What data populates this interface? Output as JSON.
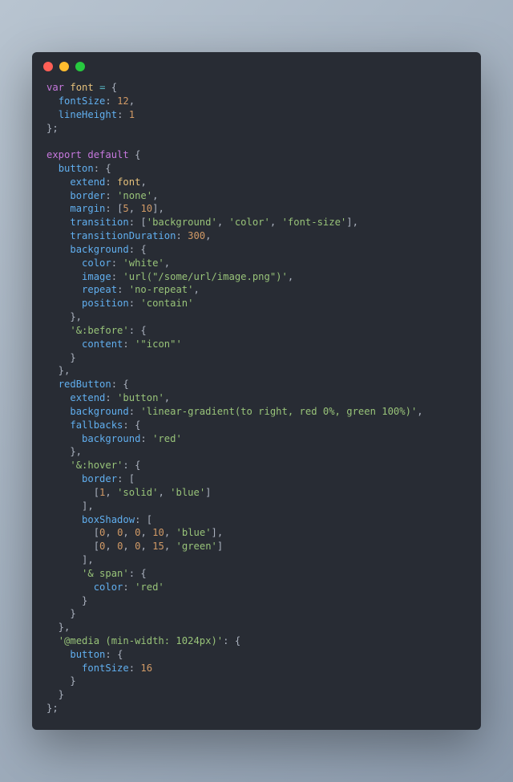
{
  "titlebar": {
    "dots": [
      "close",
      "minimize",
      "zoom"
    ]
  },
  "code": {
    "tokens": [
      [
        [
          "k",
          "var"
        ],
        [
          "p",
          " "
        ],
        [
          "con",
          "font"
        ],
        [
          "p",
          " "
        ],
        [
          "op",
          "="
        ],
        [
          "p",
          " {"
        ]
      ],
      [
        [
          "p",
          "  "
        ],
        [
          "prop",
          "fontSize"
        ],
        [
          "p",
          ": "
        ],
        [
          "num",
          "12"
        ],
        [
          "p",
          ","
        ]
      ],
      [
        [
          "p",
          "  "
        ],
        [
          "prop",
          "lineHeight"
        ],
        [
          "p",
          ": "
        ],
        [
          "num",
          "1"
        ]
      ],
      [
        [
          "p",
          "};"
        ]
      ],
      [
        [
          "p",
          ""
        ]
      ],
      [
        [
          "k",
          "export"
        ],
        [
          "p",
          " "
        ],
        [
          "k",
          "default"
        ],
        [
          "p",
          " {"
        ]
      ],
      [
        [
          "p",
          "  "
        ],
        [
          "prop",
          "button"
        ],
        [
          "p",
          ": {"
        ]
      ],
      [
        [
          "p",
          "    "
        ],
        [
          "prop",
          "extend"
        ],
        [
          "p",
          ": "
        ],
        [
          "con",
          "font"
        ],
        [
          "p",
          ","
        ]
      ],
      [
        [
          "p",
          "    "
        ],
        [
          "prop",
          "border"
        ],
        [
          "p",
          ": "
        ],
        [
          "str",
          "'none'"
        ],
        [
          "p",
          ","
        ]
      ],
      [
        [
          "p",
          "    "
        ],
        [
          "prop",
          "margin"
        ],
        [
          "p",
          ": ["
        ],
        [
          "num",
          "5"
        ],
        [
          "p",
          ", "
        ],
        [
          "num",
          "10"
        ],
        [
          "p",
          "],"
        ]
      ],
      [
        [
          "p",
          "    "
        ],
        [
          "prop",
          "transition"
        ],
        [
          "p",
          ": ["
        ],
        [
          "str",
          "'background'"
        ],
        [
          "p",
          ", "
        ],
        [
          "str",
          "'color'"
        ],
        [
          "p",
          ", "
        ],
        [
          "str",
          "'font-size'"
        ],
        [
          "p",
          "],"
        ]
      ],
      [
        [
          "p",
          "    "
        ],
        [
          "prop",
          "transitionDuration"
        ],
        [
          "p",
          ": "
        ],
        [
          "num",
          "300"
        ],
        [
          "p",
          ","
        ]
      ],
      [
        [
          "p",
          "    "
        ],
        [
          "prop",
          "background"
        ],
        [
          "p",
          ": {"
        ]
      ],
      [
        [
          "p",
          "      "
        ],
        [
          "prop",
          "color"
        ],
        [
          "p",
          ": "
        ],
        [
          "str",
          "'white'"
        ],
        [
          "p",
          ","
        ]
      ],
      [
        [
          "p",
          "      "
        ],
        [
          "prop",
          "image"
        ],
        [
          "p",
          ": "
        ],
        [
          "str",
          "'url(\"/some/url/image.png\")'"
        ],
        [
          "p",
          ","
        ]
      ],
      [
        [
          "p",
          "      "
        ],
        [
          "prop",
          "repeat"
        ],
        [
          "p",
          ": "
        ],
        [
          "str",
          "'no-repeat'"
        ],
        [
          "p",
          ","
        ]
      ],
      [
        [
          "p",
          "      "
        ],
        [
          "prop",
          "position"
        ],
        [
          "p",
          ": "
        ],
        [
          "str",
          "'contain'"
        ]
      ],
      [
        [
          "p",
          "    },"
        ]
      ],
      [
        [
          "p",
          "    "
        ],
        [
          "str",
          "'&:before'"
        ],
        [
          "p",
          ": {"
        ]
      ],
      [
        [
          "p",
          "      "
        ],
        [
          "prop",
          "content"
        ],
        [
          "p",
          ": "
        ],
        [
          "str",
          "'\"icon\"'"
        ]
      ],
      [
        [
          "p",
          "    }"
        ]
      ],
      [
        [
          "p",
          "  },"
        ]
      ],
      [
        [
          "p",
          "  "
        ],
        [
          "prop",
          "redButton"
        ],
        [
          "p",
          ": {"
        ]
      ],
      [
        [
          "p",
          "    "
        ],
        [
          "prop",
          "extend"
        ],
        [
          "p",
          ": "
        ],
        [
          "str",
          "'button'"
        ],
        [
          "p",
          ","
        ]
      ],
      [
        [
          "p",
          "    "
        ],
        [
          "prop",
          "background"
        ],
        [
          "p",
          ": "
        ],
        [
          "str",
          "'linear-gradient(to right, red 0%, green 100%)'"
        ],
        [
          "p",
          ","
        ]
      ],
      [
        [
          "p",
          "    "
        ],
        [
          "prop",
          "fallbacks"
        ],
        [
          "p",
          ": {"
        ]
      ],
      [
        [
          "p",
          "      "
        ],
        [
          "prop",
          "background"
        ],
        [
          "p",
          ": "
        ],
        [
          "str",
          "'red'"
        ]
      ],
      [
        [
          "p",
          "    },"
        ]
      ],
      [
        [
          "p",
          "    "
        ],
        [
          "str",
          "'&:hover'"
        ],
        [
          "p",
          ": {"
        ]
      ],
      [
        [
          "p",
          "      "
        ],
        [
          "prop",
          "border"
        ],
        [
          "p",
          ": ["
        ]
      ],
      [
        [
          "p",
          "        ["
        ],
        [
          "num",
          "1"
        ],
        [
          "p",
          ", "
        ],
        [
          "str",
          "'solid'"
        ],
        [
          "p",
          ", "
        ],
        [
          "str",
          "'blue'"
        ],
        [
          "p",
          "]"
        ]
      ],
      [
        [
          "p",
          "      ],"
        ]
      ],
      [
        [
          "p",
          "      "
        ],
        [
          "prop",
          "boxShadow"
        ],
        [
          "p",
          ": ["
        ]
      ],
      [
        [
          "p",
          "        ["
        ],
        [
          "num",
          "0"
        ],
        [
          "p",
          ", "
        ],
        [
          "num",
          "0"
        ],
        [
          "p",
          ", "
        ],
        [
          "num",
          "0"
        ],
        [
          "p",
          ", "
        ],
        [
          "num",
          "10"
        ],
        [
          "p",
          ", "
        ],
        [
          "str",
          "'blue'"
        ],
        [
          "p",
          "],"
        ]
      ],
      [
        [
          "p",
          "        ["
        ],
        [
          "num",
          "0"
        ],
        [
          "p",
          ", "
        ],
        [
          "num",
          "0"
        ],
        [
          "p",
          ", "
        ],
        [
          "num",
          "0"
        ],
        [
          "p",
          ", "
        ],
        [
          "num",
          "15"
        ],
        [
          "p",
          ", "
        ],
        [
          "str",
          "'green'"
        ],
        [
          "p",
          "]"
        ]
      ],
      [
        [
          "p",
          "      ],"
        ]
      ],
      [
        [
          "p",
          "      "
        ],
        [
          "str",
          "'& span'"
        ],
        [
          "p",
          ": {"
        ]
      ],
      [
        [
          "p",
          "        "
        ],
        [
          "prop",
          "color"
        ],
        [
          "p",
          ": "
        ],
        [
          "str",
          "'red'"
        ]
      ],
      [
        [
          "p",
          "      }"
        ]
      ],
      [
        [
          "p",
          "    }"
        ]
      ],
      [
        [
          "p",
          "  },"
        ]
      ],
      [
        [
          "p",
          "  "
        ],
        [
          "str",
          "'@media (min-width: 1024px)'"
        ],
        [
          "p",
          ": {"
        ]
      ],
      [
        [
          "p",
          "    "
        ],
        [
          "prop",
          "button"
        ],
        [
          "p",
          ": {"
        ]
      ],
      [
        [
          "p",
          "      "
        ],
        [
          "prop",
          "fontSize"
        ],
        [
          "p",
          ": "
        ],
        [
          "num",
          "16"
        ]
      ],
      [
        [
          "p",
          "    }"
        ]
      ],
      [
        [
          "p",
          "  }"
        ]
      ],
      [
        [
          "p",
          "};"
        ]
      ]
    ]
  }
}
